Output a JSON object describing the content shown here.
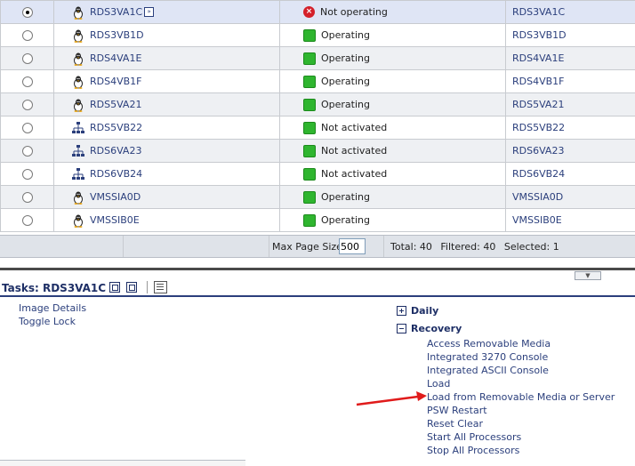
{
  "rows": [
    {
      "name": "RDS3VA1C",
      "icon": "linux-penguin-icon",
      "status": "Not operating",
      "status_type": "error",
      "host": "RDS3VA1C",
      "selected": true,
      "menu": true
    },
    {
      "name": "RDS3VB1D",
      "icon": "linux-penguin-icon",
      "status": "Operating",
      "status_type": "ok",
      "host": "RDS3VB1D"
    },
    {
      "name": "RDS4VA1E",
      "icon": "linux-penguin-icon",
      "status": "Operating",
      "status_type": "ok",
      "host": "RDS4VA1E"
    },
    {
      "name": "RDS4VB1F",
      "icon": "linux-penguin-icon",
      "status": "Operating",
      "status_type": "ok",
      "host": "RDS4VB1F"
    },
    {
      "name": "RDS5VA21",
      "icon": "linux-penguin-icon",
      "status": "Operating",
      "status_type": "ok",
      "host": "RDS5VA21"
    },
    {
      "name": "RDS5VB22",
      "icon": "network-tree-icon",
      "status": "Not activated",
      "status_type": "ok",
      "host": "RDS5VB22"
    },
    {
      "name": "RDS6VA23",
      "icon": "network-tree-icon",
      "status": "Not activated",
      "status_type": "ok",
      "host": "RDS6VA23"
    },
    {
      "name": "RDS6VB24",
      "icon": "network-tree-icon",
      "status": "Not activated",
      "status_type": "ok",
      "host": "RDS6VB24"
    },
    {
      "name": "VMSSIA0D",
      "icon": "linux-penguin-icon",
      "status": "Operating",
      "status_type": "ok",
      "host": "VMSSIA0D"
    },
    {
      "name": "VMSSIB0E",
      "icon": "linux-penguin-icon",
      "status": "Operating",
      "status_type": "ok",
      "host": "VMSSIB0E"
    }
  ],
  "footer": {
    "page_size_label": "Max Page Size:",
    "page_size_value": "500",
    "total": "Total: 40",
    "filtered": "Filtered: 40",
    "selected": "Selected: 1"
  },
  "tasks": {
    "title": "Tasks: RDS3VA1C",
    "left_links": [
      "Image Details",
      "Toggle Lock"
    ],
    "daily_label": "Daily",
    "recovery_label": "Recovery",
    "recovery_links": [
      "Access Removable Media",
      "Integrated 3270 Console",
      "Integrated ASCII Console",
      "Load",
      "Load from Removable Media or Server",
      "PSW Restart",
      "Reset Clear",
      "Start All Processors",
      "Stop All Processors"
    ]
  },
  "colors": {
    "link": "#2b3f7c",
    "ok": "#2fb52f",
    "error": "#d4202a",
    "annotation_arrow": "#e01b1b"
  }
}
